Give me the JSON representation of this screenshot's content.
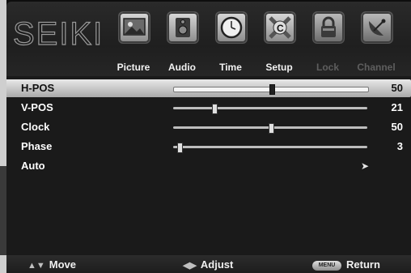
{
  "brand": {
    "logo_text": "SEIKI"
  },
  "tabs": [
    {
      "label": "Picture",
      "icon": "picture-icon",
      "enabled": true
    },
    {
      "label": "Audio",
      "icon": "audio-speaker-icon",
      "enabled": true
    },
    {
      "label": "Time",
      "icon": "clock-icon",
      "enabled": true
    },
    {
      "label": "Setup",
      "icon": "setup-icon",
      "enabled": true,
      "active": true
    },
    {
      "label": "Lock",
      "icon": "lock-icon",
      "enabled": false
    },
    {
      "label": "Channel",
      "icon": "satellite-dish-icon",
      "enabled": false
    }
  ],
  "settings": [
    {
      "label": "H-POS",
      "value": "50",
      "level": 0.5,
      "selected": true
    },
    {
      "label": "V-POS",
      "value": "21",
      "level": 0.21
    },
    {
      "label": "Clock",
      "value": "50",
      "level": 0.5
    },
    {
      "label": "Phase",
      "value": "3",
      "level": 0.03
    },
    {
      "label": "Auto",
      "value": "",
      "has_submenu_arrow": true
    }
  ],
  "footer": {
    "move": {
      "label": "Move",
      "icon": "up-down-arrows-icon"
    },
    "adjust": {
      "label": "Adjust",
      "icon": "left-right-arrows-icon"
    },
    "return": {
      "label": "Return",
      "key_label": "MENU"
    }
  }
}
